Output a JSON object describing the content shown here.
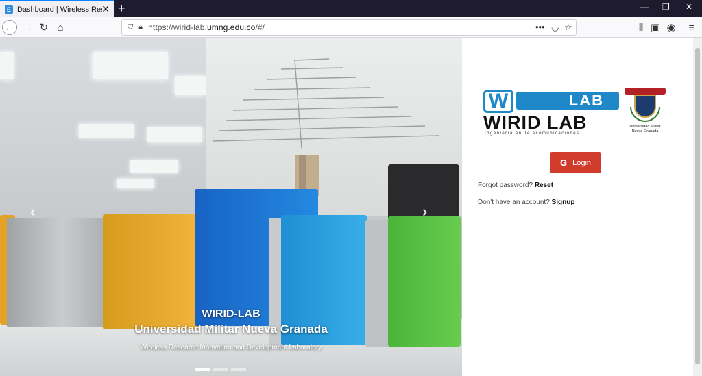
{
  "browser": {
    "tab_favicon": "E",
    "tab_title": "Dashboard | Wireless Research I",
    "url_prefix": "https://wirid-lab.",
    "url_domain": "umng.edu.co",
    "url_suffix": "/#/"
  },
  "carousel": {
    "caption_title": "WIRID-LAB",
    "caption_subtitle": "Universidad Militar Nueva Granada",
    "caption_text": "Wireless Research Innovation and Development Laboratory",
    "slide_count": 3,
    "active_slide": 1
  },
  "branding": {
    "logo_w": "W",
    "logo_lab": "LAB",
    "logo_main": "WIRID LAB",
    "logo_tagline": "Ingeniería en Telecomunicaciones",
    "crest_line1": "Universidad Militar",
    "crest_line2": "Nueva Granada"
  },
  "login": {
    "button_icon": "G",
    "button_label": "Login",
    "forgot_text": "Forgot password?",
    "forgot_link": "Reset",
    "signup_text": "Don't have an account?",
    "signup_link": "Signup"
  },
  "colors": {
    "login_red": "#d13b2c",
    "brand_blue": "#1e88c9"
  }
}
